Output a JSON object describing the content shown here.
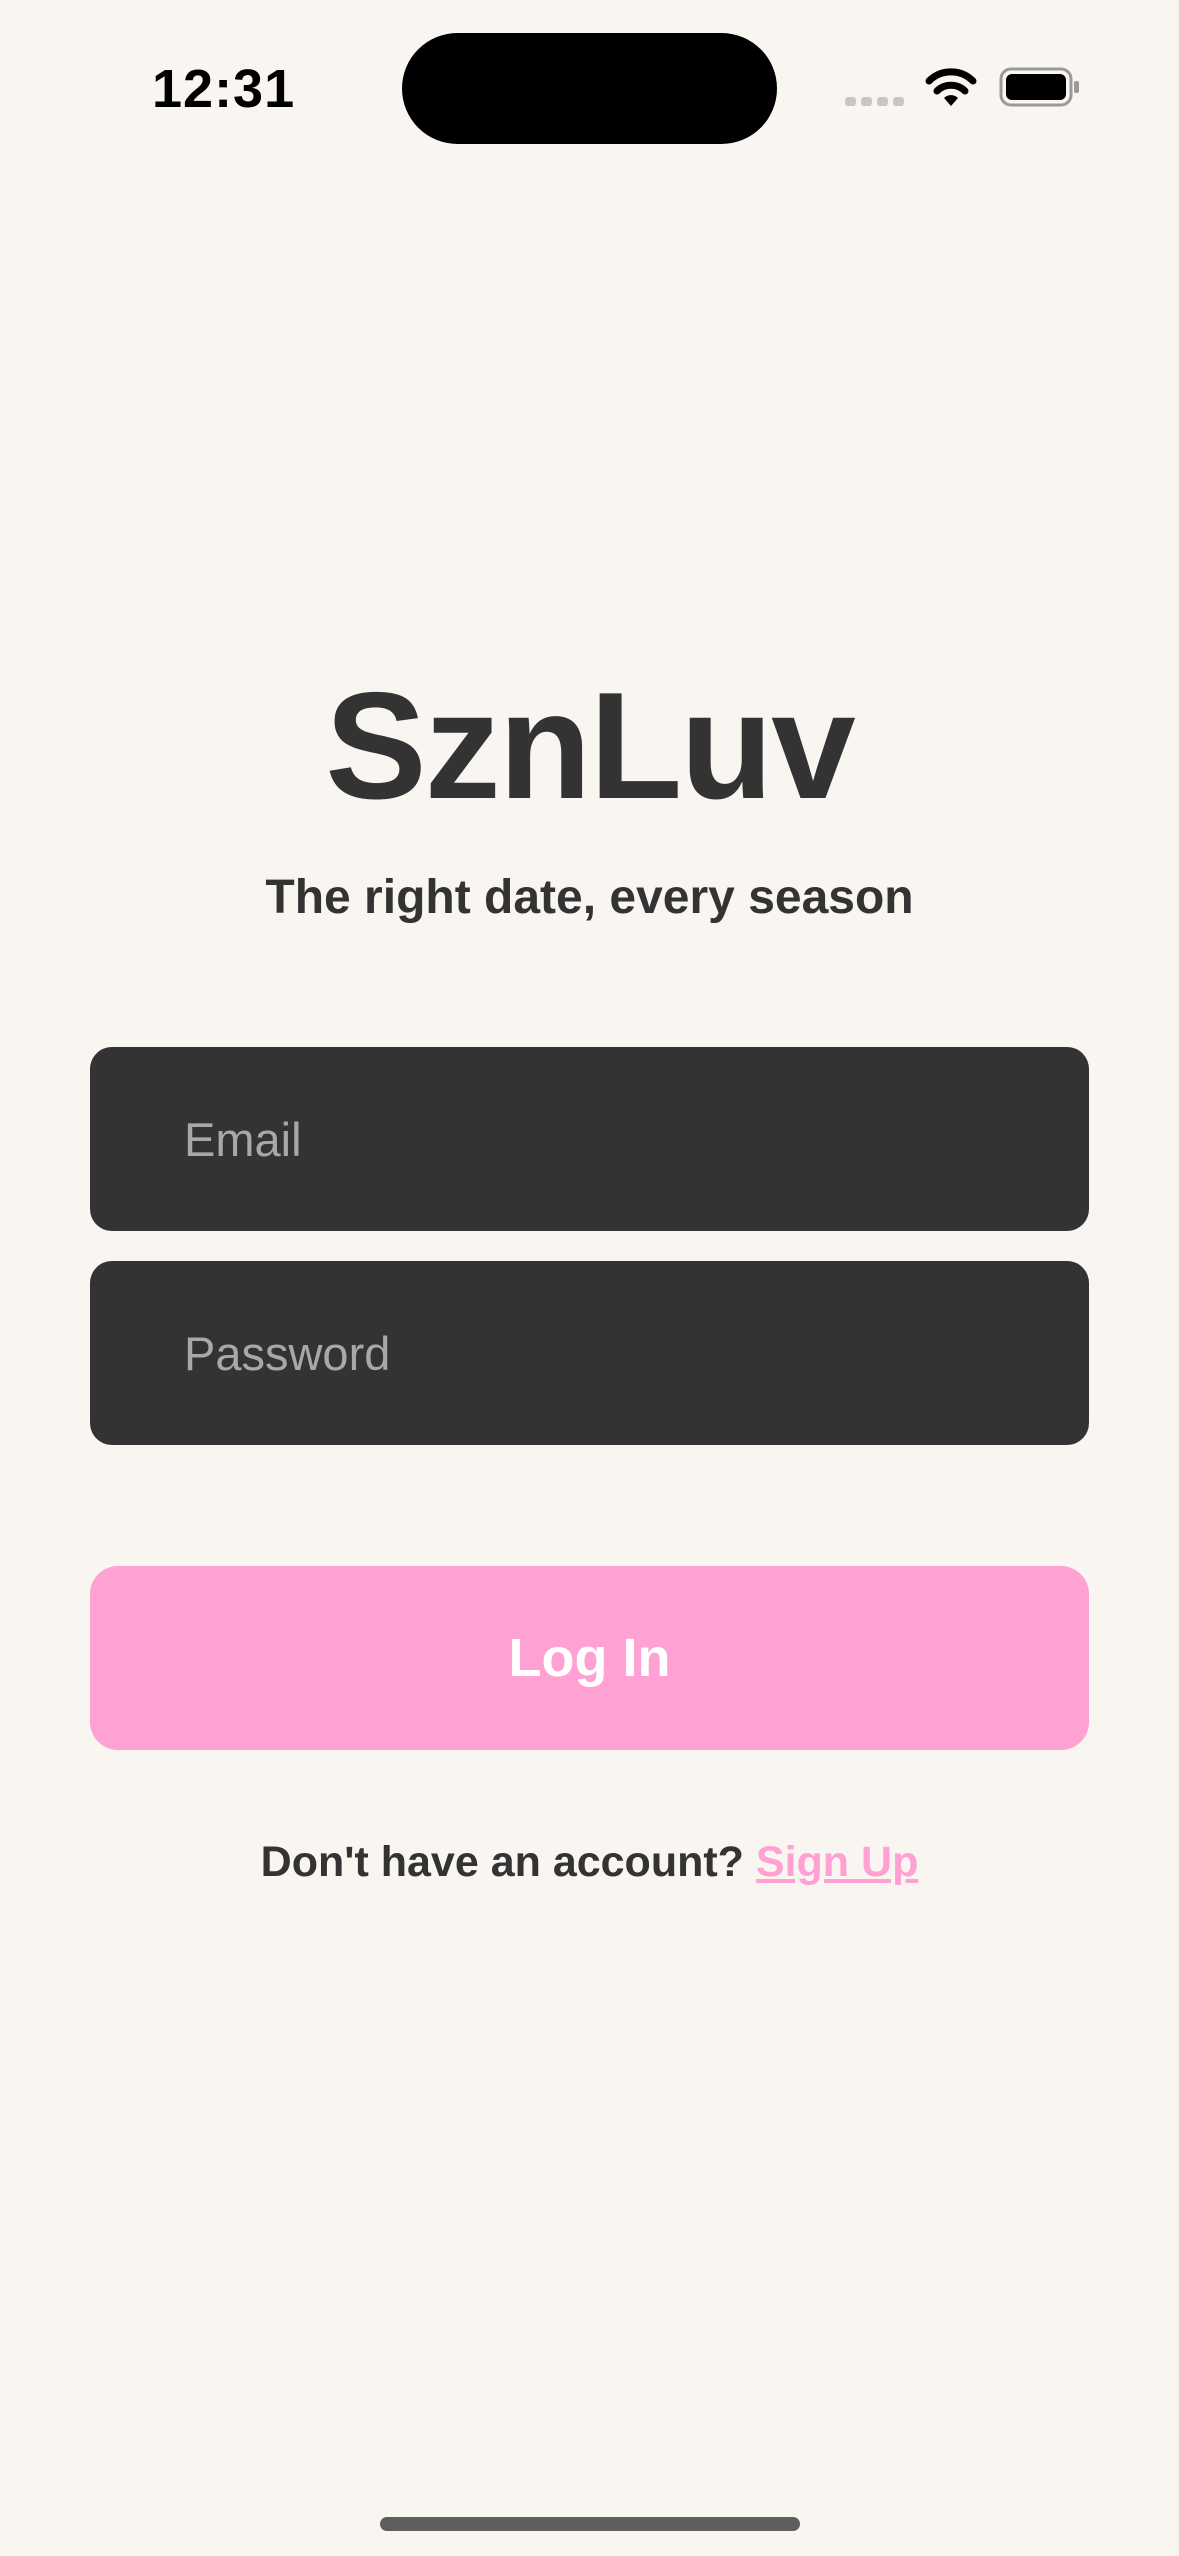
{
  "status_bar": {
    "time": "12:31",
    "icons": [
      "cellular-signal-icon",
      "wifi-icon",
      "battery-icon"
    ]
  },
  "brand": {
    "title": "SznLuv",
    "tagline": "The right date, every season"
  },
  "form": {
    "email": {
      "placeholder": "Email",
      "value": ""
    },
    "password": {
      "placeholder": "Password",
      "value": ""
    },
    "login_label": "Log In"
  },
  "signup": {
    "prompt": "Don't have an account?",
    "link_label": "Sign Up"
  },
  "colors": {
    "background": "#F9F5F1",
    "text": "#333333",
    "input_background": "#333333",
    "placeholder": "#A8A8A8",
    "accent": "#FFA1D2"
  }
}
